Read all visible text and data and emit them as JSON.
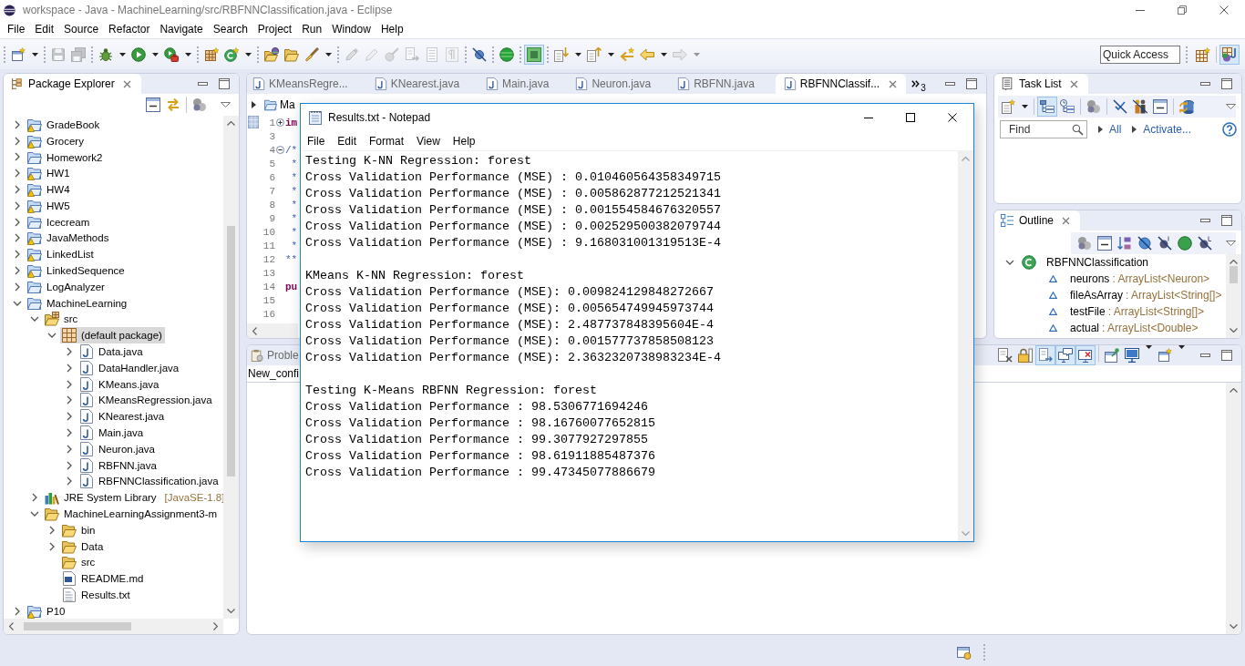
{
  "window": {
    "title": "workspace - Java - MachineLearning/src/RBFNNClassification.java - Eclipse"
  },
  "menu": [
    "File",
    "Edit",
    "Source",
    "Refactor",
    "Navigate",
    "Search",
    "Project",
    "Run",
    "Window",
    "Help"
  ],
  "toolbar": {
    "buttons": [
      {
        "disabled": false,
        "pressed": false
      },
      {
        "disabled": true,
        "pressed": false
      },
      {
        "disabled": true,
        "pressed": false
      },
      {
        "disabled": false,
        "pressed": false
      },
      {
        "disabled": false,
        "pressed": false
      },
      {
        "disabled": false,
        "pressed": false
      },
      {
        "disabled": false,
        "pressed": false
      },
      {
        "disabled": false,
        "pressed": false
      },
      {
        "disabled": false,
        "pressed": false
      },
      {
        "disabled": false,
        "pressed": false
      },
      {
        "disabled": false,
        "pressed": false
      },
      {
        "disabled": true,
        "pressed": false
      },
      {
        "disabled": true,
        "pressed": false
      },
      {
        "disabled": true,
        "pressed": false
      },
      {
        "disabled": true,
        "pressed": false
      },
      {
        "disabled": true,
        "pressed": false
      },
      {
        "disabled": true,
        "pressed": false
      },
      {
        "disabled": false,
        "pressed": false
      },
      {
        "disabled": false,
        "pressed": false
      },
      {
        "disabled": false,
        "pressed": true
      },
      {
        "disabled": false,
        "pressed": false
      },
      {
        "disabled": false,
        "pressed": false
      },
      {
        "disabled": false,
        "pressed": false
      },
      {
        "disabled": false,
        "pressed": false
      },
      {
        "disabled": true,
        "pressed": false
      }
    ],
    "quick_access": {
      "placeholder": "Quick Access"
    },
    "perspectives": [
      {
        "selected": false
      },
      {
        "selected": true
      }
    ]
  },
  "package_explorer": {
    "title": "Package Explorer",
    "items": [
      {
        "label": "GradeBook",
        "kind": "project",
        "warning": true,
        "expanded": false,
        "selected": false
      },
      {
        "label": "Grocery",
        "kind": "project",
        "warning": true,
        "expanded": false,
        "selected": false
      },
      {
        "label": "Homework2",
        "kind": "project",
        "warning": false,
        "expanded": false,
        "selected": false
      },
      {
        "label": "HW1",
        "kind": "project",
        "warning": true,
        "expanded": false,
        "selected": false
      },
      {
        "label": "HW4",
        "kind": "project",
        "warning": true,
        "expanded": false,
        "selected": false
      },
      {
        "label": "HW5",
        "kind": "project",
        "warning": true,
        "expanded": false,
        "selected": false
      },
      {
        "label": "Icecream",
        "kind": "project",
        "warning": false,
        "expanded": false,
        "selected": false
      },
      {
        "label": "JavaMethods",
        "kind": "project",
        "warning": true,
        "expanded": false,
        "selected": false
      },
      {
        "label": "LinkedList",
        "kind": "project",
        "warning": true,
        "expanded": false,
        "selected": false
      },
      {
        "label": "LinkedSequence",
        "kind": "project",
        "warning": true,
        "expanded": false,
        "selected": false
      },
      {
        "label": "LogAnalyzer",
        "kind": "project",
        "warning": false,
        "expanded": false,
        "selected": false
      },
      {
        "label": "MachineLearning",
        "kind": "project",
        "warning": false,
        "expanded": true,
        "selected": false,
        "children": [
          {
            "label": "src",
            "kind": "source-folder",
            "expanded": true,
            "selected": false,
            "children": [
              {
                "label": "(default package)",
                "kind": "package",
                "expanded": true,
                "selected": true,
                "children": [
                  {
                    "label": "Data.java",
                    "kind": "java",
                    "expanded": false,
                    "selected": false
                  },
                  {
                    "label": "DataHandler.java",
                    "kind": "java",
                    "expanded": false,
                    "selected": false
                  },
                  {
                    "label": "KMeans.java",
                    "kind": "java",
                    "expanded": false,
                    "selected": false
                  },
                  {
                    "label": "KMeansRegression.java",
                    "kind": "java",
                    "expanded": false,
                    "selected": false
                  },
                  {
                    "label": "KNearest.java",
                    "kind": "java",
                    "expanded": false,
                    "selected": false
                  },
                  {
                    "label": "Main.java",
                    "kind": "java",
                    "expanded": false,
                    "selected": false
                  },
                  {
                    "label": "Neuron.java",
                    "kind": "java",
                    "expanded": false,
                    "selected": false
                  },
                  {
                    "label": "RBFNN.java",
                    "kind": "java",
                    "expanded": false,
                    "selected": false
                  },
                  {
                    "label": "RBFNNClassification.java",
                    "kind": "java",
                    "expanded": false,
                    "selected": false
                  }
                ]
              }
            ]
          },
          {
            "label": "JRE System Library",
            "decoration": "[JavaSE-1.8]",
            "kind": "library",
            "expanded": false,
            "selected": false
          },
          {
            "label": "MachineLearningAssignment3-m",
            "kind": "folder",
            "expanded": true,
            "selected": false,
            "children": [
              {
                "label": "bin",
                "kind": "folder",
                "expanded": false,
                "selected": false
              },
              {
                "label": "Data",
                "kind": "folder",
                "expanded": false,
                "selected": false
              },
              {
                "label": "src",
                "kind": "folder",
                "selected": false
              },
              {
                "label": "README.md",
                "kind": "markdown-file",
                "selected": false
              },
              {
                "label": "Results.txt",
                "kind": "text-file",
                "selected": false
              }
            ]
          }
        ]
      },
      {
        "label": "P10",
        "kind": "project",
        "warning": true,
        "expanded": false,
        "selected": false
      }
    ]
  },
  "editor": {
    "tabs": [
      {
        "label": "KMeansRegre...",
        "selected": false
      },
      {
        "label": "KNearest.java",
        "selected": false
      },
      {
        "label": "Main.java",
        "selected": false
      },
      {
        "label": "Neuron.java",
        "selected": false
      },
      {
        "label": "RBFNN.java",
        "selected": false
      },
      {
        "label": "RBFNNClassif...",
        "selected": true
      }
    ],
    "hidden_tab_count": "3",
    "breadcrumb": "Ma",
    "lines": [
      {
        "number": "1",
        "collapsed": true,
        "text": "im",
        "kind": "keyword"
      },
      {
        "number": "3"
      },
      {
        "number": "4",
        "collapsed": false,
        "text": "/*",
        "kind": "comment"
      },
      {
        "number": "5",
        "text": " *",
        "kind": "comment"
      },
      {
        "number": "6",
        "text": " *",
        "kind": "comment"
      },
      {
        "number": "7",
        "text": " *",
        "kind": "comment"
      },
      {
        "number": "8",
        "text": " *",
        "kind": "comment"
      },
      {
        "number": "9",
        "text": " *",
        "kind": "comment"
      },
      {
        "number": "10",
        "text": " *",
        "kind": "comment"
      },
      {
        "number": "11",
        "text": " *",
        "kind": "comment"
      },
      {
        "number": "12",
        "text": "**",
        "kind": "comment"
      },
      {
        "number": "13"
      },
      {
        "number": "14",
        "text": "pu",
        "kind": "keyword"
      },
      {
        "number": "15"
      },
      {
        "number": "16"
      }
    ]
  },
  "task_list": {
    "title": "Task List",
    "toolbar": [
      {
        "pressed": false
      },
      {
        "pressed": true
      },
      {
        "pressed": false
      },
      {
        "pressed": false
      },
      {
        "pressed": false
      },
      {
        "pressed": false
      },
      {
        "pressed": false
      },
      {
        "pressed": false
      }
    ],
    "find": {
      "placeholder": "Find"
    },
    "links": [
      "All",
      "Activate..."
    ]
  },
  "outline": {
    "title": "Outline",
    "items": [
      {
        "label": "RBFNNClassification",
        "kind": "class",
        "expanded": true,
        "selected": false,
        "children": [
          {
            "label": "neurons",
            "type": ": ArrayList<Neuron>",
            "kind": "field",
            "selected": false
          },
          {
            "label": "fileAsArray",
            "type": ": ArrayList<String[]>",
            "kind": "field",
            "selected": false
          },
          {
            "label": "testFile",
            "type": ": ArrayList<String[]>",
            "kind": "field",
            "selected": false
          },
          {
            "label": "actual",
            "type": ": ArrayList<Double>",
            "kind": "field",
            "selected": false
          }
        ]
      }
    ]
  },
  "bottom_panel": {
    "tabs": [
      {
        "label": "Proble",
        "selected": false
      }
    ],
    "console_name": "New_confi",
    "toolbar": [
      {
        "pressed": false
      },
      {
        "pressed": false
      },
      {
        "pressed": true
      },
      {
        "pressed": true
      },
      {
        "pressed": true
      },
      {
        "pressed": false
      },
      {
        "pressed": false
      },
      {
        "pressed": false
      }
    ]
  },
  "notepad": {
    "title": "Results.txt - Notepad",
    "menu": [
      "File",
      "Edit",
      "Format",
      "View",
      "Help"
    ],
    "paragraphs": [
      [
        "Testing K-NN Regression: forest",
        "Cross Validation Performance (MSE) : 0.010460564358349715",
        "Cross Validation Performance (MSE) : 0.005862877212521341",
        "Cross Validation Performance (MSE) : 0.001554584676320557",
        "Cross Validation Performance (MSE) : 0.002529500382079744",
        "Cross Validation Performance (MSE) : 9.168031001319513E-4"
      ],
      [
        "KMeans K-NN Regression: forest",
        "Cross Validation Performance (MSE): 0.009824129848272667",
        "Cross Validation Performance (MSE): 0.005654749945973744",
        "Cross Validation Performance (MSE): 2.487737848395604E-4",
        "Cross Validation Performance (MSE): 0.001577737858508123",
        "Cross Validation Performance (MSE): 2.3632320738983234E-4"
      ],
      [
        "Testing K-Means RBFNN Regression: forest",
        "Cross Validation Performance : 98.5306771694246",
        "Cross Validation Performance : 98.16760077652815",
        "Cross Validation Performance : 99.3077927297855",
        "Cross Validation Performance : 98.61911885487376",
        "Cross Validation Performance : 99.47345077886679"
      ]
    ]
  }
}
